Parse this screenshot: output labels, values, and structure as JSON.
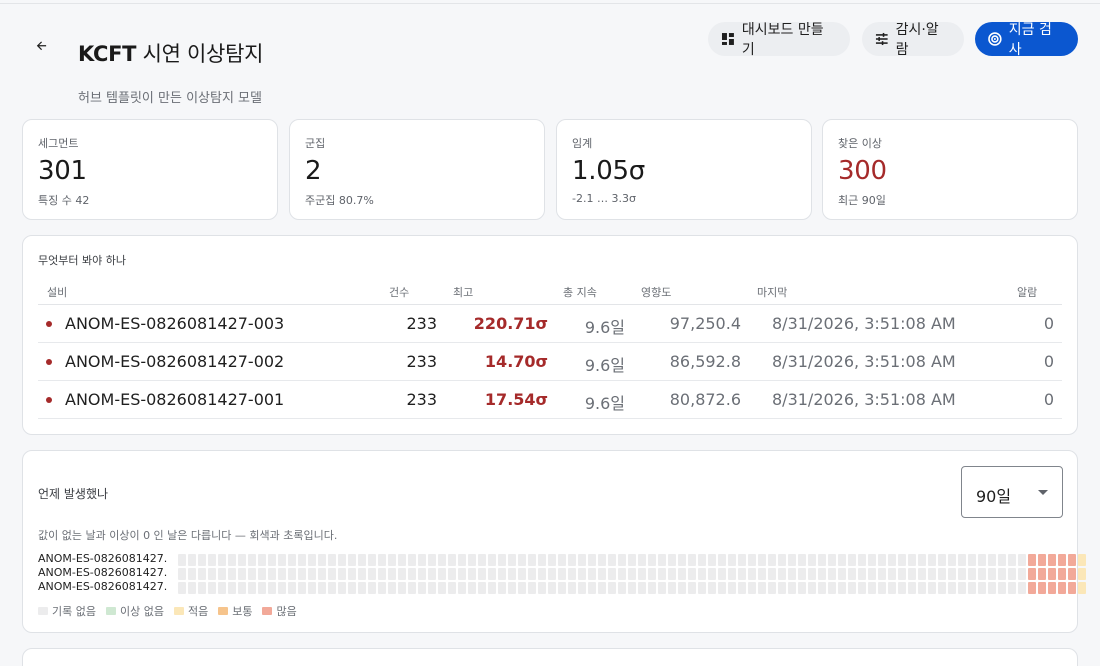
{
  "header": {
    "title_bold": "KCFT",
    "title_rest": "시연 이상탐지",
    "subtitle": "허브 템플릿이 만든 이상탐지 모델",
    "buttons": {
      "dashboard": "대시보드 만들기",
      "watch": "감시·알람",
      "scan": "지금 검사"
    }
  },
  "stats": [
    {
      "label": "세그먼트",
      "value": "301",
      "sub": "특징 수 42"
    },
    {
      "label": "군집",
      "value": "2",
      "sub": "주군집 80.7%"
    },
    {
      "label": "임계",
      "value": "1.05σ",
      "sub": "-2.1 … 3.3σ"
    },
    {
      "label": "찾은 이상",
      "value": "300",
      "sub": "최근 90일"
    }
  ],
  "table": {
    "title": "무엇부터 봐야 하나",
    "columns": {
      "equipment": "설비",
      "count": "건수",
      "max": "최고",
      "duration": "총 지속",
      "impact": "영향도",
      "last": "마지막",
      "alarm": "알람"
    },
    "rows": [
      {
        "name": "ANOM-ES-0826081427-003",
        "count": "233",
        "max": "220.71σ",
        "duration": "9.6일",
        "impact": "97,250.4",
        "last": "8/31/2026, 3:51:08 AM",
        "alarm": "0"
      },
      {
        "name": "ANOM-ES-0826081427-002",
        "count": "233",
        "max": "14.70σ",
        "duration": "9.6일",
        "impact": "86,592.8",
        "last": "8/31/2026, 3:51:08 AM",
        "alarm": "0"
      },
      {
        "name": "ANOM-ES-0826081427-001",
        "count": "233",
        "max": "17.54σ",
        "duration": "9.6일",
        "impact": "80,872.6",
        "last": "8/31/2026, 3:51:08 AM",
        "alarm": "0"
      }
    ]
  },
  "heatmap": {
    "title": "언제 발생했나",
    "range_value": "90일",
    "note": "값이 없는 날과 이상이 0 인 날은 다릅니다 — 회색과 초록입니다.",
    "rows": [
      {
        "label": "ANOM-ES-0826081427...",
        "levels": [
          0,
          0,
          0,
          0,
          0,
          0,
          0,
          0,
          0,
          0,
          0,
          0,
          0,
          0,
          0,
          0,
          0,
          0,
          0,
          0,
          0,
          0,
          0,
          0,
          0,
          0,
          0,
          0,
          0,
          0,
          0,
          0,
          0,
          0,
          0,
          0,
          0,
          0,
          0,
          0,
          0,
          0,
          0,
          0,
          0,
          0,
          0,
          0,
          0,
          0,
          0,
          0,
          0,
          0,
          0,
          0,
          0,
          0,
          0,
          0,
          0,
          0,
          0,
          0,
          0,
          0,
          0,
          0,
          0,
          0,
          0,
          0,
          0,
          0,
          0,
          0,
          0,
          0,
          0,
          0,
          0,
          0,
          0,
          0,
          0,
          4,
          4,
          4,
          4,
          4,
          2
        ]
      },
      {
        "label": "ANOM-ES-0826081427...",
        "levels": [
          0,
          0,
          0,
          0,
          0,
          0,
          0,
          0,
          0,
          0,
          0,
          0,
          0,
          0,
          0,
          0,
          0,
          0,
          0,
          0,
          0,
          0,
          0,
          0,
          0,
          0,
          0,
          0,
          0,
          0,
          0,
          0,
          0,
          0,
          0,
          0,
          0,
          0,
          0,
          0,
          0,
          0,
          0,
          0,
          0,
          0,
          0,
          0,
          0,
          0,
          0,
          0,
          0,
          0,
          0,
          0,
          0,
          0,
          0,
          0,
          0,
          0,
          0,
          0,
          0,
          0,
          0,
          0,
          0,
          0,
          0,
          0,
          0,
          0,
          0,
          0,
          0,
          0,
          0,
          0,
          0,
          0,
          0,
          0,
          0,
          4,
          4,
          4,
          4,
          4,
          2
        ]
      },
      {
        "label": "ANOM-ES-0826081427...",
        "levels": [
          0,
          0,
          0,
          0,
          0,
          0,
          0,
          0,
          0,
          0,
          0,
          0,
          0,
          0,
          0,
          0,
          0,
          0,
          0,
          0,
          0,
          0,
          0,
          0,
          0,
          0,
          0,
          0,
          0,
          0,
          0,
          0,
          0,
          0,
          0,
          0,
          0,
          0,
          0,
          0,
          0,
          0,
          0,
          0,
          0,
          0,
          0,
          0,
          0,
          0,
          0,
          0,
          0,
          0,
          0,
          0,
          0,
          0,
          0,
          0,
          0,
          0,
          0,
          0,
          0,
          0,
          0,
          0,
          0,
          0,
          0,
          0,
          0,
          0,
          0,
          0,
          0,
          0,
          0,
          0,
          0,
          0,
          0,
          0,
          0,
          4,
          4,
          4,
          4,
          4,
          2
        ]
      }
    ],
    "legend": [
      {
        "label": "기록 없음",
        "color": "#ececed"
      },
      {
        "label": "이상 없음",
        "color": "#cfe8d2"
      },
      {
        "label": "적음",
        "color": "#fbe7b8"
      },
      {
        "label": "보통",
        "color": "#f6c48c"
      },
      {
        "label": "많음",
        "color": "#f2a999"
      }
    ]
  },
  "colors": {
    "accent": "#0b57d0",
    "anomaly_red": "#a52a2a"
  },
  "icons": {
    "back": "arrow-back-icon",
    "dashboard": "dashboard-icon",
    "watch": "tune-icon",
    "scan": "radar-icon",
    "select": "caret-down-icon"
  }
}
